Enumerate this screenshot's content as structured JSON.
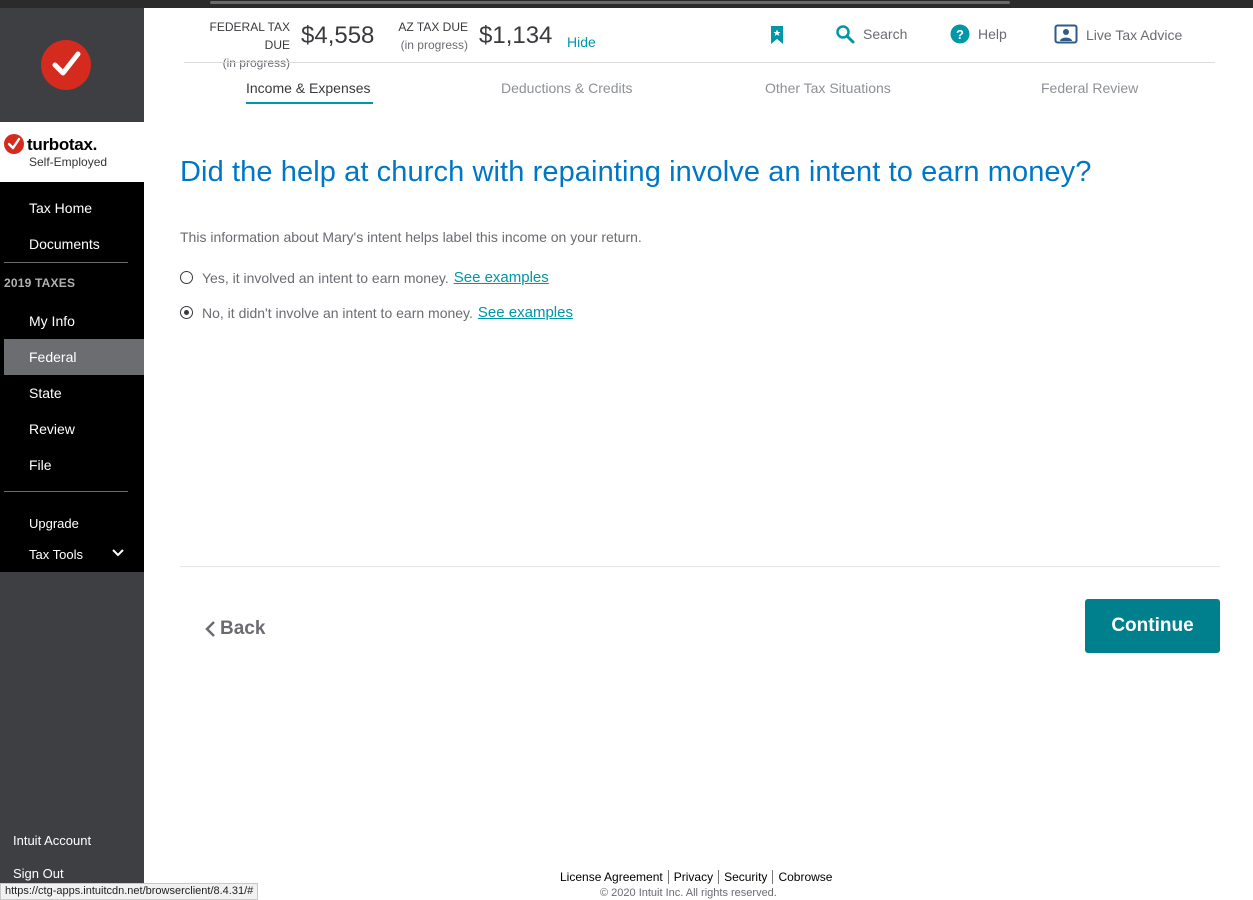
{
  "header": {
    "federal_label": "FEDERAL TAX DUE",
    "federal_sub": "(in progress)",
    "federal_amount": "$4,558",
    "state_label": "AZ TAX DUE",
    "state_sub": "(in progress)",
    "state_amount": "$1,134",
    "hide_label": "Hide",
    "search_label": "Search",
    "help_label": "Help",
    "live_advice_label": "Live Tax Advice"
  },
  "tabs": [
    {
      "label": "Income & Expenses",
      "active": true
    },
    {
      "label": "Deductions & Credits",
      "active": false
    },
    {
      "label": "Other Tax Situations",
      "active": false
    },
    {
      "label": "Federal Review",
      "active": false
    }
  ],
  "sidebar": {
    "brand_name": "turbotax.",
    "brand_sub": "Self-Employed",
    "section_label": "2019 TAXES",
    "items": [
      {
        "label": "Tax Home"
      },
      {
        "label": "Documents"
      },
      {
        "label": "My Info"
      },
      {
        "label": "Federal",
        "active": true
      },
      {
        "label": "State"
      },
      {
        "label": "Review"
      },
      {
        "label": "File"
      },
      {
        "label": "Upgrade"
      },
      {
        "label": "Tax Tools"
      }
    ],
    "intuit_account": "Intuit Account",
    "sign_out": "Sign Out"
  },
  "main": {
    "question": "Did the help at church with repainting involve an intent to earn money?",
    "info": "This information about Mary's intent helps label this income on your return.",
    "options": [
      {
        "label": "Yes, it involved an intent to earn money.",
        "link": "See examples",
        "selected": false
      },
      {
        "label": "No, it didn't involve an intent to earn money.",
        "link": "See examples",
        "selected": true
      }
    ],
    "back_label": "Back",
    "continue_label": "Continue"
  },
  "footer": {
    "links": [
      "License Agreement",
      "Privacy",
      "Security",
      "Cobrowse"
    ],
    "copyright": "© 2020 Intuit Inc. All rights reserved."
  },
  "status_url": "https://ctg-apps.intuitcdn.net/browserclient/8.4.31/#",
  "colors": {
    "accent": "#0097a7",
    "question": "#0077c5",
    "continue": "#00808c",
    "brand_red": "#d52b1e"
  }
}
